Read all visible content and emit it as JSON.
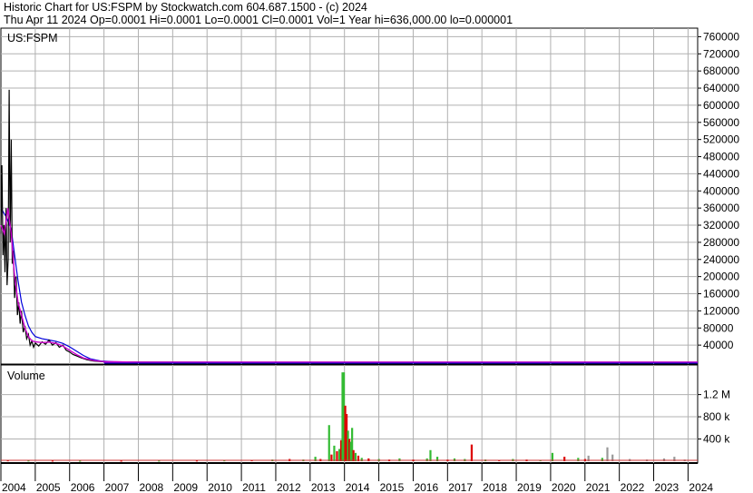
{
  "header": {
    "line1": "Historic Chart for US:FSPM by Stockwatch.com 604.687.1500 - (c) 2024",
    "line2": "Thu Apr 11 2024   Op=0.0001   Hi=0.0001   Lo=0.0001   Cl=0.0001   Vol=1   Year hi=636,000.00   lo=0.000001"
  },
  "colors": {
    "price": "#000000",
    "ma_short": "#cc00cc",
    "ma_long": "#0000dd",
    "volume_up": "#33bb33",
    "volume_down": "#dd0000",
    "volume_neutral": "#999999",
    "grid": "#b0b0b0"
  },
  "chart_data": [
    {
      "type": "line",
      "title": "US:FSPM",
      "series": [],
      "y_ticks": [
        "760000",
        "720000",
        "680000",
        "640000",
        "600000",
        "560000",
        "520000",
        "480000",
        "440000",
        "400000",
        "360000",
        "320000",
        "280000",
        "240000",
        "200000",
        "160000",
        "120000",
        "80000",
        "40000"
      ],
      "ylim": [
        0,
        780000
      ],
      "x_ticks": [
        "2004",
        "2005",
        "2006",
        "2007",
        "2008",
        "2009",
        "2010",
        "2011",
        "2012",
        "2013",
        "2014",
        "2015",
        "2016",
        "2017",
        "2018",
        "2019",
        "2020",
        "2021",
        "2022",
        "2023",
        "2024"
      ],
      "price_points": [
        [
          2004.0,
          300000
        ],
        [
          2004.03,
          460000
        ],
        [
          2004.06,
          250000
        ],
        [
          2004.09,
          320000
        ],
        [
          2004.12,
          210000
        ],
        [
          2004.15,
          360000
        ],
        [
          2004.18,
          180000
        ],
        [
          2004.21,
          240000
        ],
        [
          2004.24,
          636000
        ],
        [
          2004.27,
          280000
        ],
        [
          2004.3,
          520000
        ],
        [
          2004.33,
          230000
        ],
        [
          2004.36,
          260000
        ],
        [
          2004.4,
          150000
        ],
        [
          2004.44,
          200000
        ],
        [
          2004.48,
          110000
        ],
        [
          2004.52,
          140000
        ],
        [
          2004.56,
          90000
        ],
        [
          2004.6,
          120000
        ],
        [
          2004.65,
          70000
        ],
        [
          2004.7,
          85000
        ],
        [
          2004.75,
          55000
        ],
        [
          2004.8,
          65000
        ],
        [
          2004.85,
          40000
        ],
        [
          2004.9,
          50000
        ],
        [
          2004.95,
          35000
        ],
        [
          2005.0,
          45000
        ],
        [
          2005.1,
          38000
        ],
        [
          2005.2,
          48000
        ],
        [
          2005.3,
          42000
        ],
        [
          2005.4,
          52000
        ],
        [
          2005.5,
          40000
        ],
        [
          2005.6,
          46000
        ],
        [
          2005.7,
          35000
        ],
        [
          2005.8,
          40000
        ],
        [
          2005.9,
          28000
        ],
        [
          2006.0,
          24000
        ],
        [
          2006.1,
          18000
        ],
        [
          2006.2,
          15000
        ],
        [
          2006.35,
          10000
        ],
        [
          2006.5,
          6000
        ],
        [
          2006.7,
          3000
        ],
        [
          2007.0,
          1000
        ],
        [
          2008.0,
          200
        ],
        [
          2012.0,
          50
        ],
        [
          2024.28,
          0.0001
        ]
      ],
      "ma_short_points": [
        [
          2004.0,
          320000
        ],
        [
          2004.1,
          300000
        ],
        [
          2004.2,
          360000
        ],
        [
          2004.3,
          300000
        ],
        [
          2004.4,
          200000
        ],
        [
          2004.5,
          140000
        ],
        [
          2004.6,
          110000
        ],
        [
          2004.7,
          80000
        ],
        [
          2004.8,
          60000
        ],
        [
          2004.9,
          50000
        ],
        [
          2005.0,
          48000
        ],
        [
          2005.2,
          46000
        ],
        [
          2005.4,
          47000
        ],
        [
          2005.6,
          44000
        ],
        [
          2005.8,
          38000
        ],
        [
          2006.0,
          28000
        ],
        [
          2006.2,
          18000
        ],
        [
          2006.4,
          10000
        ],
        [
          2006.7,
          4000
        ],
        [
          2007.0,
          1500
        ],
        [
          2008.0,
          300
        ],
        [
          2024.28,
          0
        ]
      ],
      "ma_long_points": [
        [
          2004.0,
          360000
        ],
        [
          2004.15,
          340000
        ],
        [
          2004.3,
          310000
        ],
        [
          2004.4,
          250000
        ],
        [
          2004.5,
          190000
        ],
        [
          2004.6,
          140000
        ],
        [
          2004.7,
          110000
        ],
        [
          2004.8,
          85000
        ],
        [
          2004.9,
          70000
        ],
        [
          2005.0,
          60000
        ],
        [
          2005.2,
          55000
        ],
        [
          2005.4,
          52000
        ],
        [
          2005.6,
          49000
        ],
        [
          2005.8,
          44000
        ],
        [
          2006.0,
          36000
        ],
        [
          2006.2,
          26000
        ],
        [
          2006.4,
          16000
        ],
        [
          2006.6,
          8000
        ],
        [
          2006.9,
          3000
        ],
        [
          2007.3,
          1000
        ],
        [
          2008.0,
          300
        ],
        [
          2024.28,
          0
        ]
      ]
    },
    {
      "type": "bar",
      "title": "Volume",
      "series": [],
      "y_ticks": [
        "1.2 M",
        "800 k",
        "400 k"
      ],
      "ylim": [
        0,
        1700000
      ],
      "bars": [
        {
          "x": 2004.2,
          "v": 15000,
          "c": "down"
        },
        {
          "x": 2004.8,
          "v": 12000,
          "c": "up"
        },
        {
          "x": 2005.5,
          "v": 10000,
          "c": "down"
        },
        {
          "x": 2006.3,
          "v": 8000,
          "c": "up"
        },
        {
          "x": 2007.5,
          "v": 9000,
          "c": "down"
        },
        {
          "x": 2008.6,
          "v": 10000,
          "c": "up"
        },
        {
          "x": 2009.7,
          "v": 12000,
          "c": "down"
        },
        {
          "x": 2010.5,
          "v": 15000,
          "c": "up"
        },
        {
          "x": 2011.3,
          "v": 20000,
          "c": "down"
        },
        {
          "x": 2011.9,
          "v": 30000,
          "c": "up"
        },
        {
          "x": 2012.4,
          "v": 40000,
          "c": "down"
        },
        {
          "x": 2012.8,
          "v": 30000,
          "c": "up"
        },
        {
          "x": 2013.15,
          "v": 80000,
          "c": "up"
        },
        {
          "x": 2013.3,
          "v": 40000,
          "c": "down"
        },
        {
          "x": 2013.55,
          "v": 650000,
          "c": "up"
        },
        {
          "x": 2013.62,
          "v": 120000,
          "c": "down"
        },
        {
          "x": 2013.7,
          "v": 280000,
          "c": "up"
        },
        {
          "x": 2013.78,
          "v": 180000,
          "c": "down"
        },
        {
          "x": 2013.85,
          "v": 220000,
          "c": "up"
        },
        {
          "x": 2013.9,
          "v": 380000,
          "c": "down"
        },
        {
          "x": 2013.94,
          "v": 1600000,
          "c": "up"
        },
        {
          "x": 2013.98,
          "v": 1600000,
          "c": "up"
        },
        {
          "x": 2014.02,
          "v": 1000000,
          "c": "down"
        },
        {
          "x": 2014.06,
          "v": 850000,
          "c": "down"
        },
        {
          "x": 2014.1,
          "v": 550000,
          "c": "up"
        },
        {
          "x": 2014.14,
          "v": 400000,
          "c": "down"
        },
        {
          "x": 2014.18,
          "v": 350000,
          "c": "up"
        },
        {
          "x": 2014.22,
          "v": 600000,
          "c": "up"
        },
        {
          "x": 2014.26,
          "v": 200000,
          "c": "down"
        },
        {
          "x": 2014.32,
          "v": 150000,
          "c": "up"
        },
        {
          "x": 2014.4,
          "v": 100000,
          "c": "down"
        },
        {
          "x": 2014.5,
          "v": 60000,
          "c": "up"
        },
        {
          "x": 2014.7,
          "v": 50000,
          "c": "down"
        },
        {
          "x": 2015.0,
          "v": 40000,
          "c": "up"
        },
        {
          "x": 2015.3,
          "v": 30000,
          "c": "down"
        },
        {
          "x": 2015.6,
          "v": 50000,
          "c": "up"
        },
        {
          "x": 2016.0,
          "v": 30000,
          "c": "down"
        },
        {
          "x": 2016.4,
          "v": 50000,
          "c": "up"
        },
        {
          "x": 2016.5,
          "v": 200000,
          "c": "up"
        },
        {
          "x": 2016.7,
          "v": 80000,
          "c": "up"
        },
        {
          "x": 2017.0,
          "v": 30000,
          "c": "down"
        },
        {
          "x": 2017.2,
          "v": 50000,
          "c": "up"
        },
        {
          "x": 2017.5,
          "v": 40000,
          "c": "up"
        },
        {
          "x": 2017.7,
          "v": 300000,
          "c": "down"
        },
        {
          "x": 2018.1,
          "v": 30000,
          "c": "up"
        },
        {
          "x": 2018.5,
          "v": 20000,
          "c": "down"
        },
        {
          "x": 2018.9,
          "v": 40000,
          "c": "up"
        },
        {
          "x": 2019.3,
          "v": 30000,
          "c": "down"
        },
        {
          "x": 2019.7,
          "v": 20000,
          "c": "up"
        },
        {
          "x": 2020.05,
          "v": 150000,
          "c": "up"
        },
        {
          "x": 2020.4,
          "v": 80000,
          "c": "down"
        },
        {
          "x": 2020.8,
          "v": 60000,
          "c": "up"
        },
        {
          "x": 2021.0,
          "v": 40000,
          "c": "down"
        },
        {
          "x": 2021.1,
          "v": 100000,
          "c": "neutral"
        },
        {
          "x": 2021.5,
          "v": 60000,
          "c": "up"
        },
        {
          "x": 2021.65,
          "v": 250000,
          "c": "neutral"
        },
        {
          "x": 2021.8,
          "v": 120000,
          "c": "neutral"
        },
        {
          "x": 2022.3,
          "v": 40000,
          "c": "neutral"
        },
        {
          "x": 2022.8,
          "v": 30000,
          "c": "neutral"
        },
        {
          "x": 2023.3,
          "v": 50000,
          "c": "neutral"
        },
        {
          "x": 2023.6,
          "v": 80000,
          "c": "neutral"
        },
        {
          "x": 2023.9,
          "v": 30000,
          "c": "neutral"
        }
      ]
    }
  ]
}
